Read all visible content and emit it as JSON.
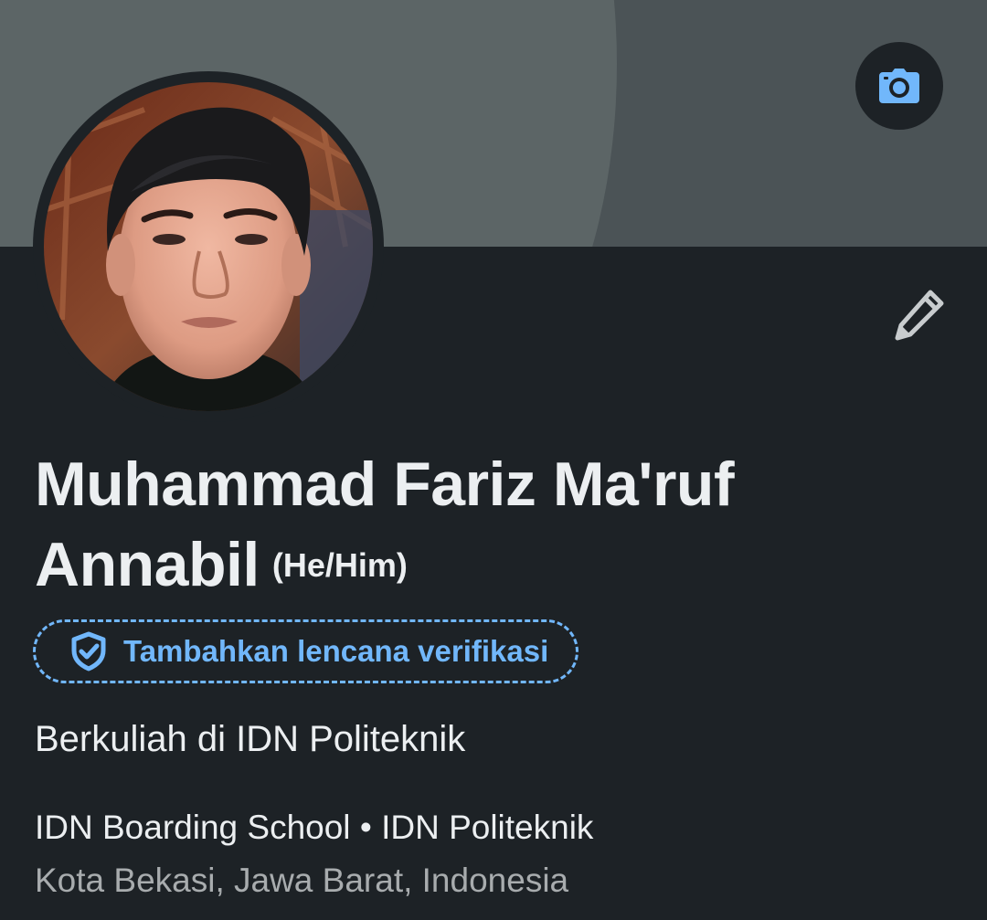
{
  "profile": {
    "name_line1": "Muhammad Fariz Ma'ruf",
    "name_line2": "Annabil",
    "pronouns": "(He/Him)",
    "verify_badge_label": "Tambahkan lencana verifikasi",
    "headline": "Berkuliah di IDN Politeknik",
    "education_1": "IDN Boarding School",
    "separator": "•",
    "education_2": "IDN Politeknik",
    "location": "Kota Bekasi, Jawa Barat, Indonesia"
  },
  "icons": {
    "camera": "camera-icon",
    "edit": "pencil-icon",
    "verify": "shield-check-icon"
  },
  "colors": {
    "background": "#1d2226",
    "cover_light": "#5c6566",
    "cover_dark": "#4b5356",
    "accent": "#71b7fb",
    "text_primary": "#eceff1",
    "text_secondary": "#a8acae"
  }
}
